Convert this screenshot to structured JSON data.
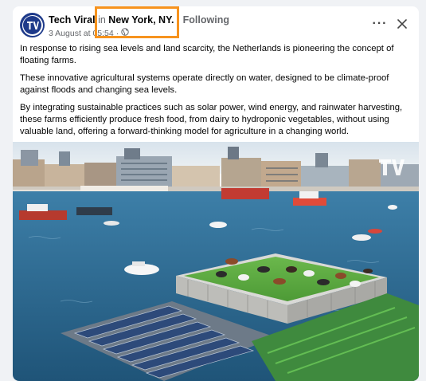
{
  "post": {
    "page_name": "Tech Viral",
    "in_text": "in",
    "location": "New York, NY.",
    "separator": "·",
    "following": "Following",
    "date": "3 August at 05:54",
    "separator2": "·",
    "more_label": "···",
    "paragraphs": [
      "In response to rising sea levels and land scarcity, the Netherlands is pioneering the concept of floating farms.",
      "These innovative agricultural systems operate directly on water, designed to be climate-proof against floods and changing sea levels.",
      "By integrating sustainable practices such as solar power, wind energy, and rainwater harvesting, these farms efficiently produce fresh food, from dairy to hydroponic vegetables, without using valuable land, offering a forward-thinking model for agriculture in a changing world."
    ]
  },
  "icons": {
    "avatar": "tv-logo-icon",
    "privacy": "globe-icon",
    "more": "more-dots-icon",
    "close": "close-icon",
    "watermark": "tv-watermark-icon"
  },
  "colors": {
    "highlight": "#f7931e",
    "avatar_bg": "#1e3a8a",
    "water": "#2f6f9b",
    "grass": "#5aa640",
    "solar": "#2d4a7a"
  }
}
